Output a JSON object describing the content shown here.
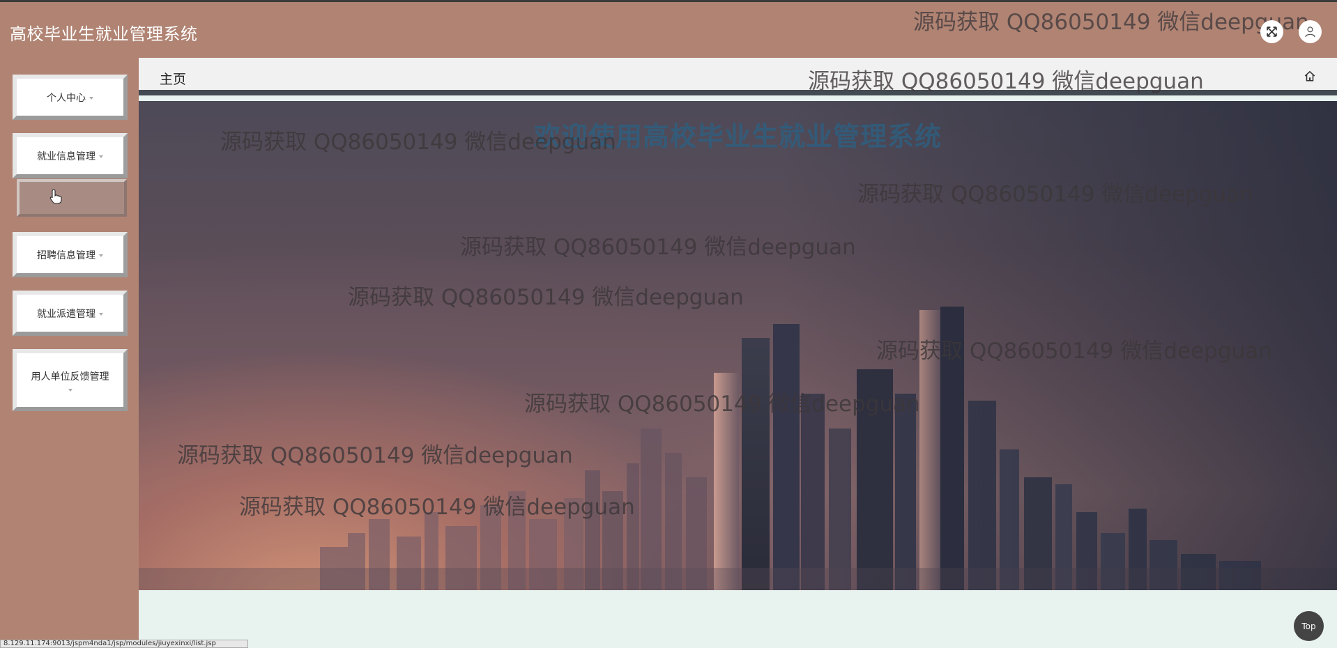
{
  "header": {
    "title": "高校毕业生就业管理系统",
    "fullscreen_icon": "expand-icon",
    "user_icon": "user-icon"
  },
  "sidebar": {
    "items": [
      {
        "label": "个人中心"
      },
      {
        "label": "就业信息管理"
      },
      {
        "label": "招聘信息管理"
      },
      {
        "label": "就业派遣管理"
      },
      {
        "label": "用人单位反馈管理"
      }
    ],
    "hovered_submenu_label": ""
  },
  "tabs": {
    "home_label": "主页",
    "home_icon": "home-icon"
  },
  "hero": {
    "welcome": "欢迎使用高校毕业生就业管理系统"
  },
  "watermark": "源码获取 QQ86050149 微信deepguan",
  "back_to_top": "Top",
  "status_url": "8.129.11.174:9013/jspm4nda1/jsp/modules/jiuyexinxi/list.jsp",
  "colors": {
    "header_bg": "#b08373",
    "main_bg": "#e8f3ef",
    "welcome_text": "#2f5e7e"
  }
}
